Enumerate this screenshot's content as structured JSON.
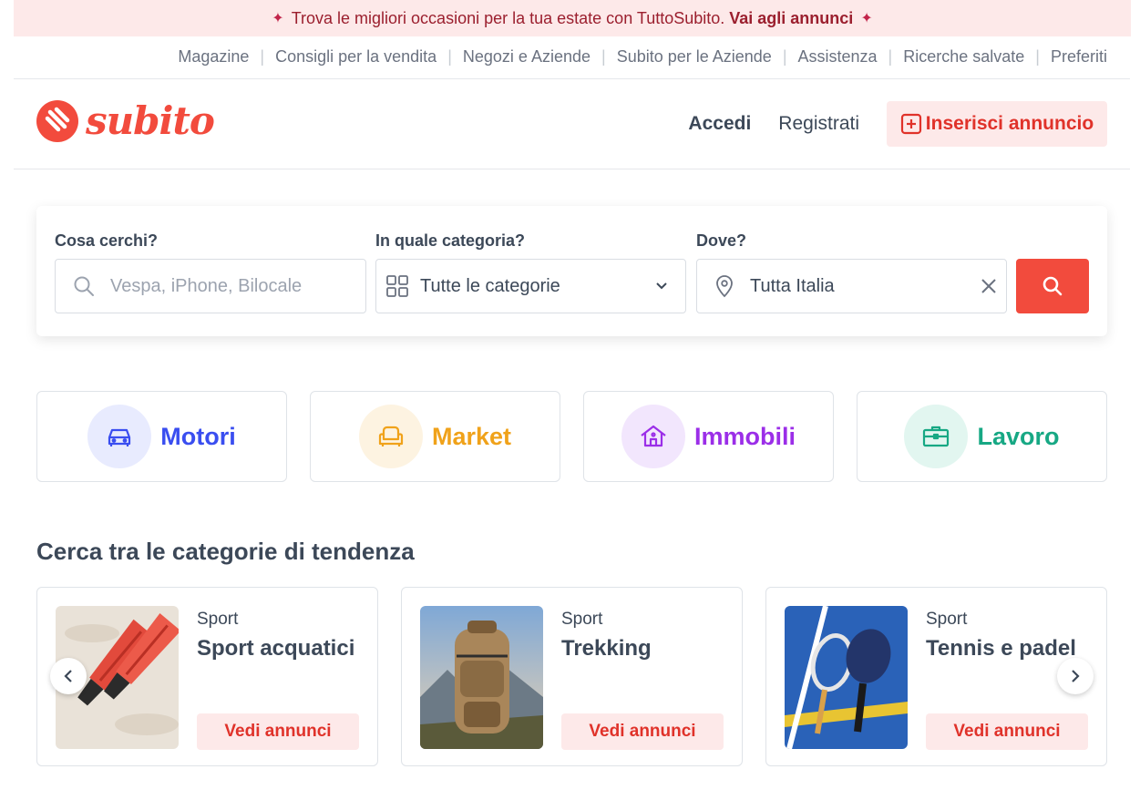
{
  "promo": {
    "text": "Trova le migliori occasioni per la tua estate con TuttoSubito.",
    "link": "Vai agli annunci"
  },
  "toplinks": [
    "Magazine",
    "Consigli per la vendita",
    "Negozi e Aziende",
    "Subito per le Aziende",
    "Assistenza",
    "Ricerche salvate",
    "Preferiti"
  ],
  "header": {
    "logo_text": "subito",
    "login": "Accedi",
    "register": "Registrati",
    "insert": "Inserisci annuncio"
  },
  "search": {
    "what_label": "Cosa cerchi?",
    "what_placeholder": "Vespa, iPhone, Bilocale",
    "category_label": "In quale categoria?",
    "category_value": "Tutte le categorie",
    "where_label": "Dove?",
    "where_value": "Tutta Italia"
  },
  "macro": [
    {
      "label": "Motori",
      "color": "#3a4ef0",
      "bg": "#e8ebfe",
      "icon": "car-icon"
    },
    {
      "label": "Market",
      "color": "#f0a21a",
      "bg": "#fdf3e1",
      "icon": "armchair-icon"
    },
    {
      "label": "Immobili",
      "color": "#9b2ee8",
      "bg": "#f2e6fd",
      "icon": "house-icon"
    },
    {
      "label": "Lavoro",
      "color": "#17a884",
      "bg": "#e2f6f0",
      "icon": "briefcase-icon"
    }
  ],
  "trending": {
    "title": "Cerca tra le categorie di tendenza",
    "cards": [
      {
        "category": "Sport",
        "name": "Sport acquatici",
        "cta": "Vedi annunci"
      },
      {
        "category": "Sport",
        "name": "Trekking",
        "cta": "Vedi annunci"
      },
      {
        "category": "Sport",
        "name": "Tennis e padel",
        "cta": "Vedi annunci"
      }
    ]
  }
}
